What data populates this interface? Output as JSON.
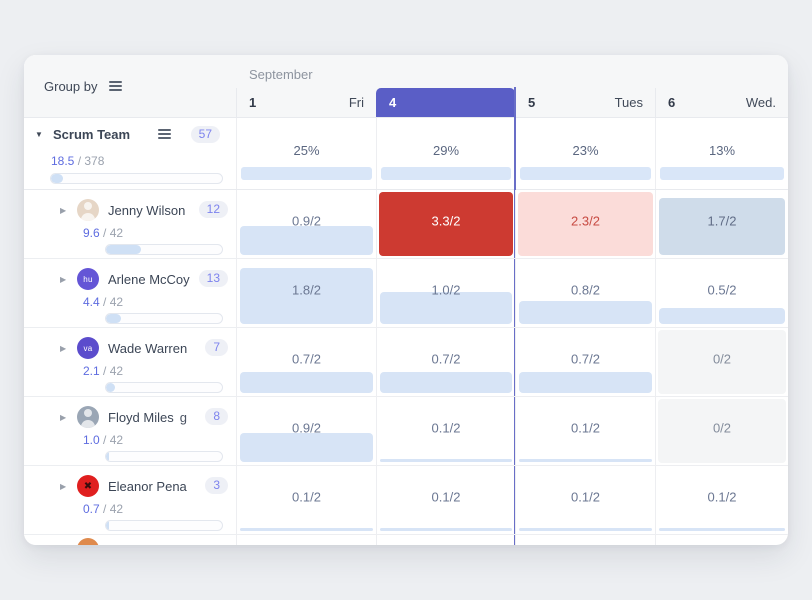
{
  "colors": {
    "accent_purple": "#5a5ec6",
    "selected_column_line": "#696ec7",
    "overload_red": "#cd3a31",
    "overload_light_red": "#fbdcd9",
    "allocation_blue": "#d7e4f6",
    "allocation_muted_blue": "#cfdcea",
    "off_day_gray": "#f4f5f6",
    "summary_bar_blue": "#d9e6f8"
  },
  "sidebar": {
    "group_by_label": "Group by",
    "group": {
      "name": "Scrum Team",
      "count": "57",
      "used": "18.5",
      "capacity": "378",
      "progress_pct": 7
    },
    "members": [
      {
        "name": "Jenny Wilson",
        "suffix": "",
        "count": "12",
        "used": "9.6",
        "capacity": "42",
        "progress_pct": 30,
        "avatar_kind": "photo",
        "avatar_bg": "#e6d6c6",
        "avatar_text": ""
      },
      {
        "name": "Arlene McCoy",
        "suffix": "",
        "count": "13",
        "used": "4.4",
        "capacity": "42",
        "progress_pct": 13,
        "avatar_kind": "initials",
        "avatar_bg": "#6455d6",
        "avatar_text": "hu"
      },
      {
        "name": "Wade Warren",
        "suffix": "",
        "count": "7",
        "used": "2.1",
        "capacity": "42",
        "progress_pct": 8,
        "avatar_kind": "initials",
        "avatar_bg": "#5b4ccc",
        "avatar_text": "va"
      },
      {
        "name": "Floyd Miles",
        "suffix": "g",
        "count": "8",
        "used": "1.0",
        "capacity": "42",
        "progress_pct": 3,
        "avatar_kind": "photo",
        "avatar_bg": "#9aa6b5",
        "avatar_text": ""
      },
      {
        "name": "Eleanor Pena",
        "suffix": "",
        "count": "3",
        "used": "0.7",
        "capacity": "42",
        "progress_pct": 2,
        "avatar_kind": "logo",
        "avatar_bg": "#e01f1f",
        "avatar_text": "✖"
      }
    ],
    "partial_member_avatar_bg": "#df8a4d"
  },
  "calendar": {
    "month_label": "September",
    "columns": [
      {
        "day": "1",
        "weekday": "Fri",
        "selected": false
      },
      {
        "day": "4",
        "weekday": "",
        "selected": true
      },
      {
        "day": "5",
        "weekday": "Tues",
        "selected": false
      },
      {
        "day": "6",
        "weekday": "Wed.",
        "selected": false
      }
    ],
    "summary_percents": [
      "25%",
      "29%",
      "23%",
      "13%"
    ],
    "rows": [
      {
        "member": "Jenny Wilson",
        "cells": [
          {
            "label": "0.9/2",
            "type": "blue",
            "fill": 0.5
          },
          {
            "label": "3.3/2",
            "type": "red",
            "fill": 1
          },
          {
            "label": "2.3/2",
            "type": "pink",
            "fill": 1
          },
          {
            "label": "1.7/2",
            "type": "muted",
            "fill": 0.88
          }
        ]
      },
      {
        "member": "Arlene McCoy",
        "cells": [
          {
            "label": "1.8/2",
            "type": "blue",
            "fill": 0.93
          },
          {
            "label": "1.0/2",
            "type": "blue",
            "fill": 0.55
          },
          {
            "label": "0.8/2",
            "type": "blue",
            "fill": 0.42
          },
          {
            "label": "0.5/2",
            "type": "blue",
            "fill": 0.3
          }
        ]
      },
      {
        "member": "Wade Warren",
        "cells": [
          {
            "label": "0.7/2",
            "type": "blue",
            "fill": 0.38
          },
          {
            "label": "0.7/2",
            "type": "blue",
            "fill": 0.38
          },
          {
            "label": "0.7/2",
            "type": "blue",
            "fill": 0.38
          },
          {
            "label": "0/2",
            "type": "off",
            "fill": 1
          }
        ]
      },
      {
        "member": "Floyd Miles",
        "cells": [
          {
            "label": "0.9/2",
            "type": "blue",
            "fill": 0.5
          },
          {
            "label": "0.1/2",
            "type": "blue",
            "fill": 0.07
          },
          {
            "label": "0.1/2",
            "type": "blue",
            "fill": 0.07
          },
          {
            "label": "0/2",
            "type": "off",
            "fill": 1
          }
        ]
      },
      {
        "member": "Eleanor Pena",
        "cells": [
          {
            "label": "0.1/2",
            "type": "blue",
            "fill": 0.07
          },
          {
            "label": "0.1/2",
            "type": "blue",
            "fill": 0.07
          },
          {
            "label": "0.1/2",
            "type": "blue",
            "fill": 0.07
          },
          {
            "label": "0.1/2",
            "type": "blue",
            "fill": 0.07
          }
        ]
      }
    ]
  }
}
